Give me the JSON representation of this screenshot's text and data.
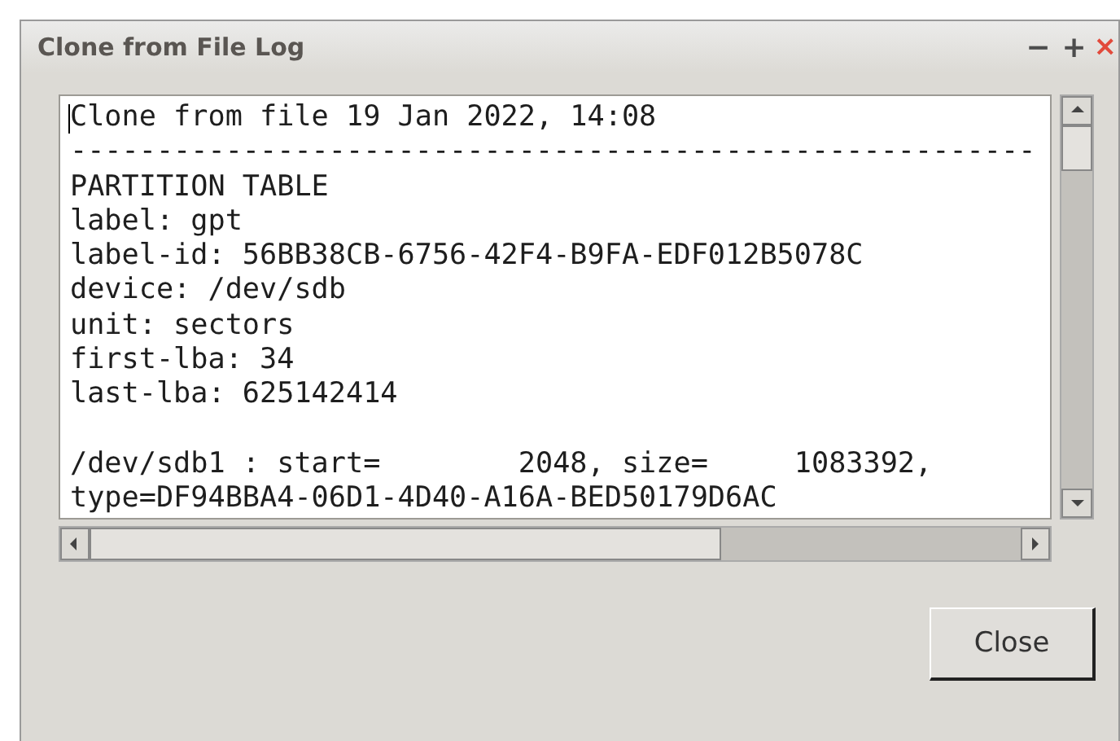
{
  "window": {
    "title": "Clone from File Log",
    "controls": [
      "−",
      "+",
      "×"
    ]
  },
  "log": {
    "paragraphs": [
      [
        "Clone from file 19 Jan 2022, 14:08",
        "--------------------------------------------------------",
        "PARTITION TABLE",
        "label: gpt",
        "label-id: 56BB38CB-6756-42F4-B9FA-EDF012B5078C",
        "device: /dev/sdb",
        "unit: sectors",
        "first-lba: 34",
        "last-lba: 625142414"
      ],
      [
        "/dev/sdb1 : start=        2048, size=     1083392,",
        "type=DF94BBA4-06D1-4D40-A16A-BED50179D6AC"
      ]
    ]
  },
  "buttons": [
    "Close"
  ]
}
